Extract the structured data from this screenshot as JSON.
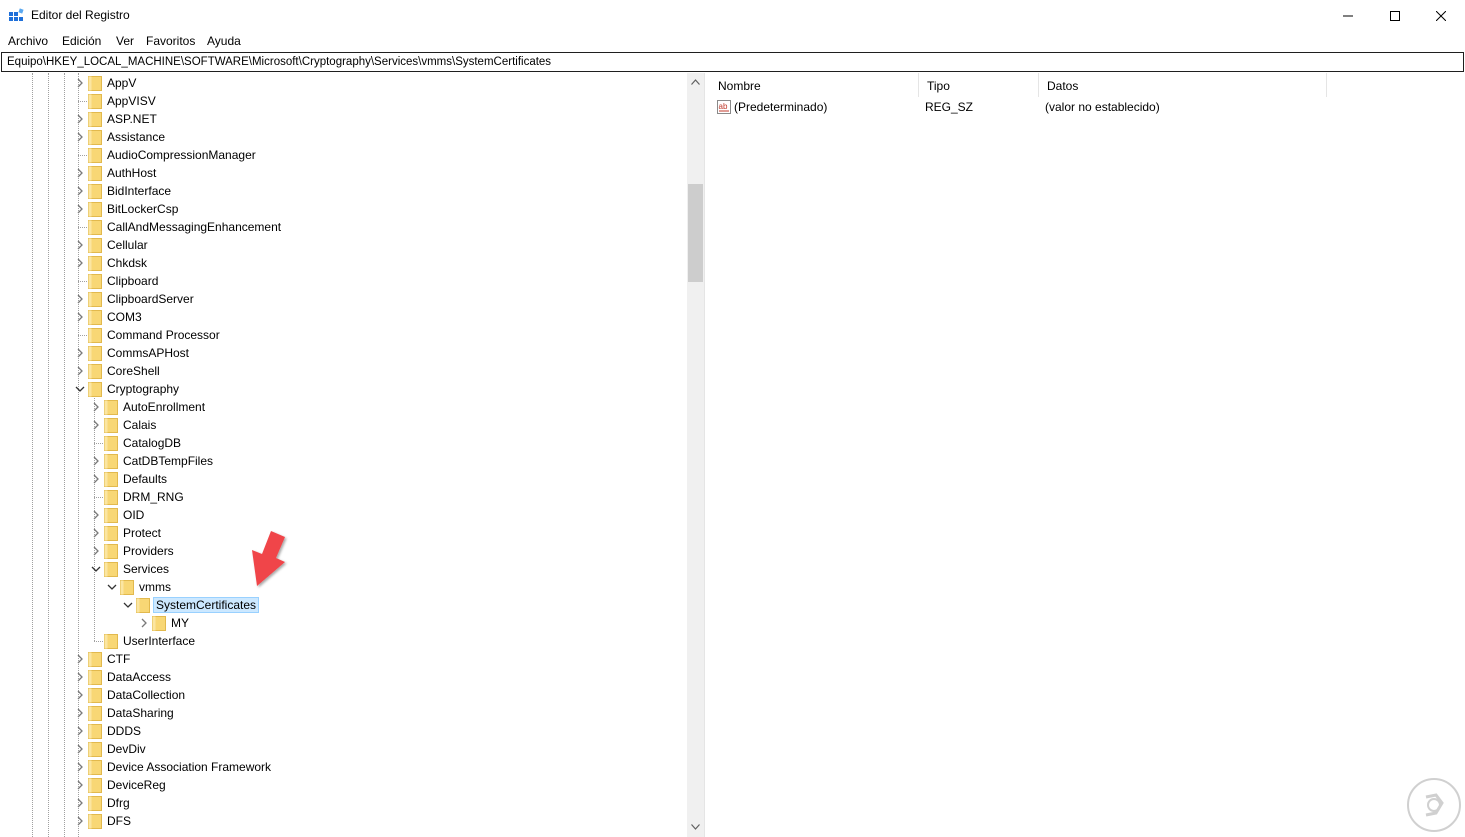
{
  "window": {
    "title": "Editor del Registro"
  },
  "menu": {
    "items": [
      "Archivo",
      "Edición",
      "Ver",
      "Favoritos",
      "Ayuda"
    ]
  },
  "address": {
    "path": "Equipo\\HKEY_LOCAL_MACHINE\\SOFTWARE\\Microsoft\\Cryptography\\Services\\vmms\\SystemCertificates"
  },
  "tree": {
    "nodes": [
      {
        "label": "AppV",
        "depth": 0,
        "expander": "collapsed"
      },
      {
        "label": "AppVISV",
        "depth": 0,
        "expander": "none"
      },
      {
        "label": "ASP.NET",
        "depth": 0,
        "expander": "collapsed"
      },
      {
        "label": "Assistance",
        "depth": 0,
        "expander": "collapsed"
      },
      {
        "label": "AudioCompressionManager",
        "depth": 0,
        "expander": "none"
      },
      {
        "label": "AuthHost",
        "depth": 0,
        "expander": "collapsed"
      },
      {
        "label": "BidInterface",
        "depth": 0,
        "expander": "collapsed"
      },
      {
        "label": "BitLockerCsp",
        "depth": 0,
        "expander": "collapsed"
      },
      {
        "label": "CallAndMessagingEnhancement",
        "depth": 0,
        "expander": "none"
      },
      {
        "label": "Cellular",
        "depth": 0,
        "expander": "collapsed"
      },
      {
        "label": "Chkdsk",
        "depth": 0,
        "expander": "collapsed"
      },
      {
        "label": "Clipboard",
        "depth": 0,
        "expander": "none"
      },
      {
        "label": "ClipboardServer",
        "depth": 0,
        "expander": "collapsed"
      },
      {
        "label": "COM3",
        "depth": 0,
        "expander": "collapsed"
      },
      {
        "label": "Command Processor",
        "depth": 0,
        "expander": "none"
      },
      {
        "label": "CommsAPHost",
        "depth": 0,
        "expander": "collapsed"
      },
      {
        "label": "CoreShell",
        "depth": 0,
        "expander": "collapsed"
      },
      {
        "label": "Cryptography",
        "depth": 0,
        "expander": "expanded"
      },
      {
        "label": "AutoEnrollment",
        "depth": 1,
        "expander": "collapsed"
      },
      {
        "label": "Calais",
        "depth": 1,
        "expander": "collapsed"
      },
      {
        "label": "CatalogDB",
        "depth": 1,
        "expander": "none"
      },
      {
        "label": "CatDBTempFiles",
        "depth": 1,
        "expander": "collapsed"
      },
      {
        "label": "Defaults",
        "depth": 1,
        "expander": "collapsed"
      },
      {
        "label": "DRM_RNG",
        "depth": 1,
        "expander": "none"
      },
      {
        "label": "OID",
        "depth": 1,
        "expander": "collapsed"
      },
      {
        "label": "Protect",
        "depth": 1,
        "expander": "collapsed"
      },
      {
        "label": "Providers",
        "depth": 1,
        "expander": "collapsed"
      },
      {
        "label": "Services",
        "depth": 1,
        "expander": "expanded"
      },
      {
        "label": "vmms",
        "depth": 2,
        "expander": "expanded"
      },
      {
        "label": "SystemCertificates",
        "depth": 3,
        "expander": "expanded",
        "selected": true
      },
      {
        "label": "MY",
        "depth": 4,
        "expander": "collapsed"
      },
      {
        "label": "UserInterface",
        "depth": 1,
        "expander": "none"
      },
      {
        "label": "CTF",
        "depth": 0,
        "expander": "collapsed"
      },
      {
        "label": "DataAccess",
        "depth": 0,
        "expander": "collapsed"
      },
      {
        "label": "DataCollection",
        "depth": 0,
        "expander": "collapsed"
      },
      {
        "label": "DataSharing",
        "depth": 0,
        "expander": "collapsed"
      },
      {
        "label": "DDDS",
        "depth": 0,
        "expander": "collapsed"
      },
      {
        "label": "DevDiv",
        "depth": 0,
        "expander": "collapsed"
      },
      {
        "label": "Device Association Framework",
        "depth": 0,
        "expander": "collapsed"
      },
      {
        "label": "DeviceReg",
        "depth": 0,
        "expander": "collapsed"
      },
      {
        "label": "Dfrg",
        "depth": 0,
        "expander": "collapsed"
      },
      {
        "label": "DFS",
        "depth": 0,
        "expander": "collapsed"
      }
    ]
  },
  "list": {
    "columns": [
      "Nombre",
      "Tipo",
      "Datos"
    ],
    "rows": [
      {
        "icon": "string-value-icon",
        "name": "(Predeterminado)",
        "type": "REG_SZ",
        "data": "(valor no establecido)"
      }
    ]
  },
  "colors": {
    "folder": "#f8d775",
    "selection": "#cce8ff",
    "annotation_arrow": "#f0454a"
  }
}
